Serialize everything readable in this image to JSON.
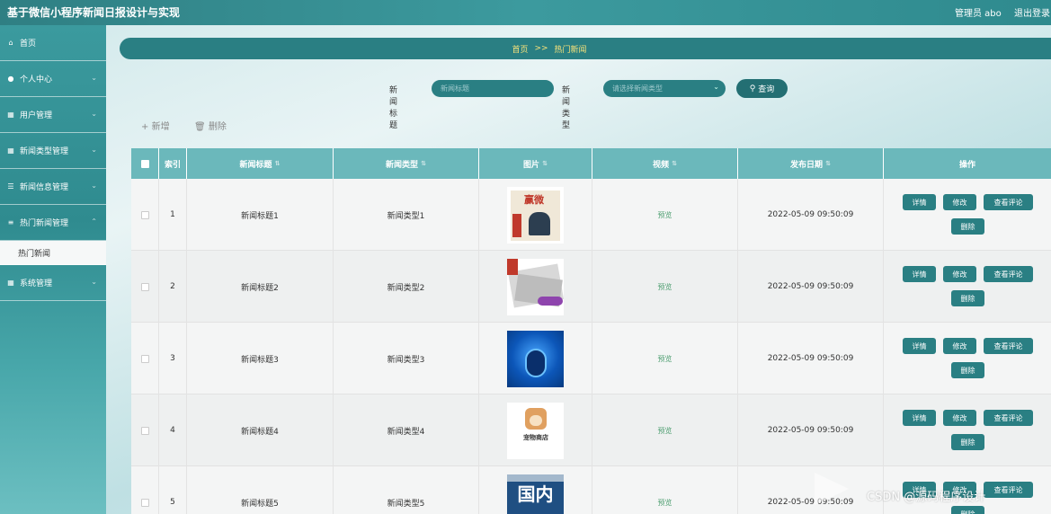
{
  "header": {
    "app_title": "基于微信小程序新闻日报设计与实现",
    "admin_label": "管理员 abo",
    "logout_label": "退出登录"
  },
  "sidebar": {
    "items": [
      {
        "label": "首页",
        "icon": "home-icon"
      },
      {
        "label": "个人中心",
        "icon": "user-icon"
      },
      {
        "label": "用户管理",
        "icon": "grid-icon"
      },
      {
        "label": "新闻类型管理",
        "icon": "grid-icon"
      },
      {
        "label": "新闻信息管理",
        "icon": "sliders-icon"
      },
      {
        "label": "热门新闻管理",
        "icon": "list-icon"
      }
    ],
    "active_sub": "热门新闻",
    "last_item": {
      "label": "系统管理",
      "icon": "grid-icon"
    }
  },
  "breadcrumb": {
    "home": "首页",
    "separator": ">>",
    "current": "热门新闻"
  },
  "search": {
    "title_label": "新闻标题",
    "title_placeholder": "新闻标题",
    "type_label": "新闻类型",
    "type_placeholder": "请选择新闻类型",
    "search_button": "查询"
  },
  "toolbar": {
    "add_label": "新增",
    "delete_label": "删除"
  },
  "table": {
    "headers": {
      "index": "索引",
      "title": "新闻标题",
      "type": "新闻类型",
      "image": "图片",
      "video": "视频",
      "date": "发布日期",
      "actions": "操作"
    },
    "rows": [
      {
        "index": "1",
        "title": "新闻标题1",
        "type": "新闻类型1",
        "video": "预览",
        "date": "2022-05-09 09:50:09"
      },
      {
        "index": "2",
        "title": "新闻标题2",
        "type": "新闻类型2",
        "video": "预览",
        "date": "2022-05-09 09:50:09"
      },
      {
        "index": "3",
        "title": "新闻标题3",
        "type": "新闻类型3",
        "video": "预览",
        "date": "2022-05-09 09:50:09"
      },
      {
        "index": "4",
        "title": "新闻标题4",
        "type": "新闻类型4",
        "video": "预览",
        "date": "2022-05-09 09:50:09"
      },
      {
        "index": "5",
        "title": "新闻标题5",
        "type": "新闻类型5",
        "video": "预览",
        "date": "2022-05-09 09:50:09"
      }
    ],
    "actions": {
      "detail": "详情",
      "edit": "修改",
      "comments": "查看评论",
      "delete": "删除"
    },
    "thumbnails": {
      "t1_title": "赢微",
      "t4_shop": "宠物商店",
      "t5_text": "国内"
    }
  },
  "watermark": {
    "text": "CSDN @源码程序设计"
  },
  "colors": {
    "primary": "#2a7f83",
    "header_row": "#6bb8bb",
    "breadcrumb_text": "#f7e27a"
  }
}
